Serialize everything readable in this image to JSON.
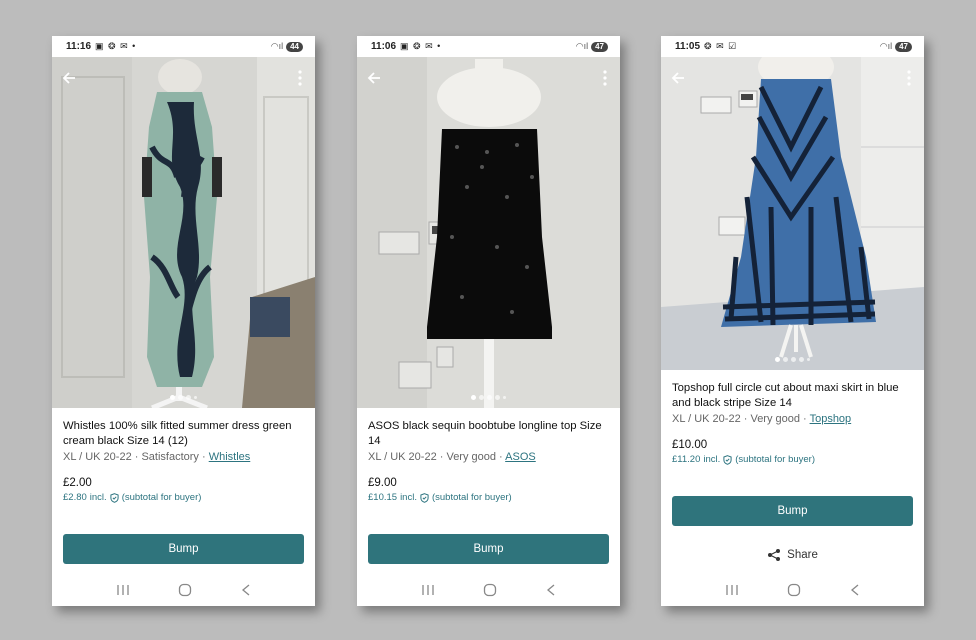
{
  "phones": [
    {
      "status_time": "11:16",
      "status_icons": "▣ ❂ ✉ •",
      "battery": "44",
      "title": "Whistles 100% silk fitted summer dress green cream black Size 14 (12)",
      "meta_prefix": "XL / UK 20-22 · Satisfactory · ",
      "brand": "Whistles",
      "price": "£2.00",
      "buyer_price": "£2.80",
      "incl_label": "incl.",
      "buyer_note": "(subtotal for buyer)",
      "bump_label": "Bump"
    },
    {
      "status_time": "11:06",
      "status_icons": "▣ ❂ ✉ •",
      "battery": "47",
      "title": "ASOS black sequin boobtube longline top Size 14",
      "meta_prefix": "XL / UK 20-22 · Very good · ",
      "brand": "ASOS",
      "price": "£9.00",
      "buyer_price": "£10.15",
      "incl_label": "incl.",
      "buyer_note": "(subtotal for buyer)",
      "bump_label": "Bump"
    },
    {
      "status_time": "11:05",
      "status_icons": "❂ ✉ ☑",
      "battery": "47",
      "title": "Topshop full circle cut about maxi skirt in blue and black stripe Size 14",
      "meta_prefix": "XL / UK 20-22 · Very good · ",
      "brand": "Topshop",
      "price": "£10.00",
      "buyer_price": "£11.20",
      "incl_label": "incl.",
      "buyer_note": "(subtotal for buyer)",
      "bump_label": "Bump",
      "share_label": "Share"
    }
  ],
  "colors": {
    "accent": "#2f747c",
    "link": "#2d7480",
    "background": "#bcbcbc"
  }
}
